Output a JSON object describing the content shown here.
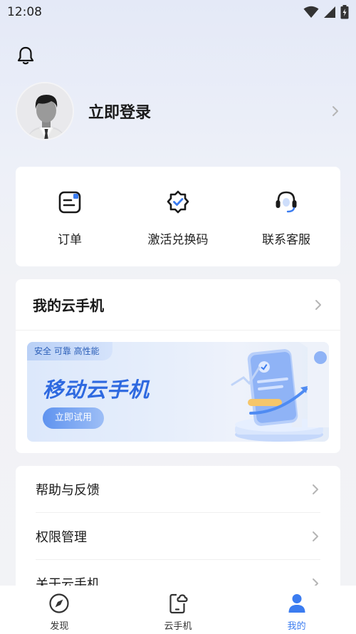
{
  "status_bar": {
    "time": "12:08"
  },
  "profile": {
    "login_label": "立即登录"
  },
  "quick_actions": [
    {
      "label": "订单",
      "icon": "order-icon"
    },
    {
      "label": "激活兑换码",
      "icon": "activation-code-icon"
    },
    {
      "label": "联系客服",
      "icon": "customer-service-icon"
    }
  ],
  "cloud_phone": {
    "title": "我的云手机",
    "banner": {
      "tag": "安全 可靠 高性能",
      "title": "移动云手机",
      "button": "立即试用"
    }
  },
  "menu": [
    {
      "label": "帮助与反馈"
    },
    {
      "label": "权限管理"
    },
    {
      "label": "关于云手机"
    }
  ],
  "tabs": [
    {
      "label": "发现",
      "icon": "compass-icon",
      "active": false
    },
    {
      "label": "云手机",
      "icon": "cloud-phone-icon",
      "active": false
    },
    {
      "label": "我的",
      "icon": "person-icon",
      "active": true
    }
  ],
  "colors": {
    "accent": "#3b7cf0",
    "banner_title": "#2e69e0"
  }
}
